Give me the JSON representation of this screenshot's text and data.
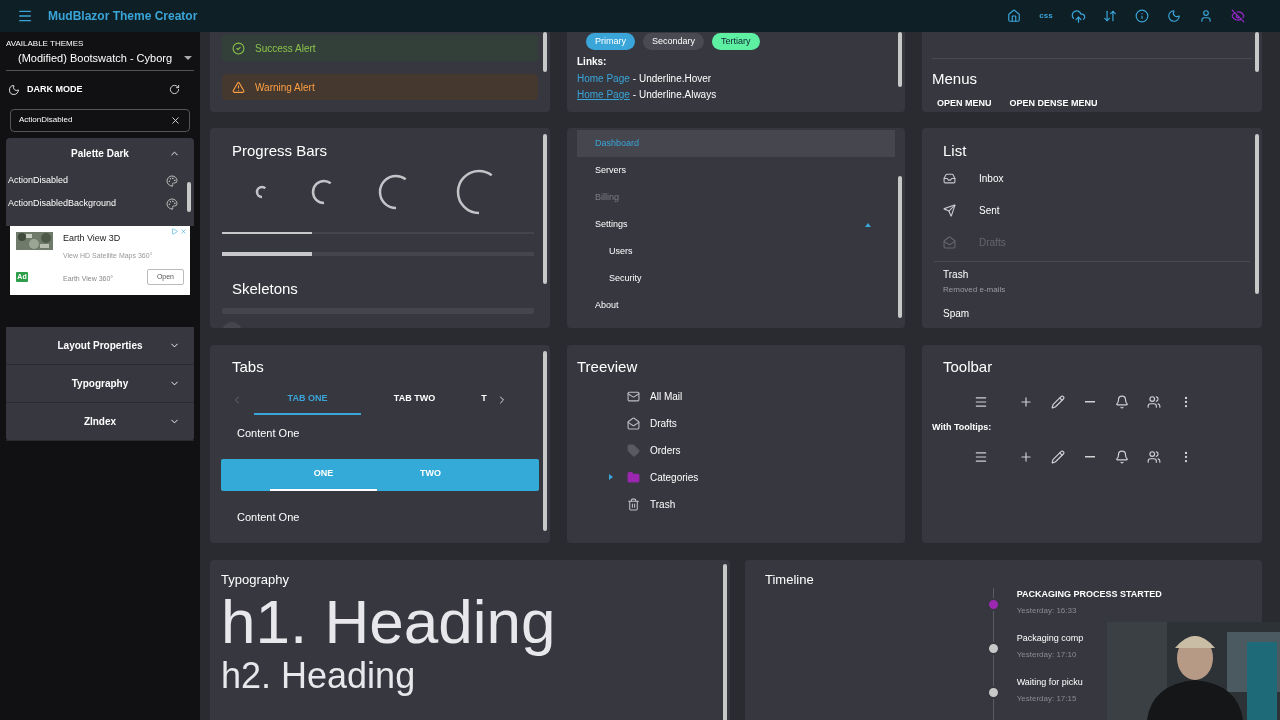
{
  "app_bar": {
    "title": "MudBlazor Theme Creator",
    "css_label": "css"
  },
  "sidebar": {
    "themes_label": "AVAILABLE THEMES",
    "theme": "(Modified) Bootswatch - Cyborg",
    "dark_mode_label": "DARK MODE",
    "search_value": "ActionDisabled",
    "palette_panel": {
      "title": "Palette Dark",
      "expanded": true,
      "items": [
        "ActionDisabled",
        "ActionDisabledBackground"
      ]
    },
    "ad": {
      "title": "Earth View 3D",
      "text": "View HD Satellite Maps 360°",
      "badge": "Ad",
      "source": "Earth View 360°",
      "button": "Open"
    },
    "panels": [
      {
        "title": "Layout Properties",
        "expanded": false
      },
      {
        "title": "Typography",
        "expanded": false
      },
      {
        "title": "ZIndex",
        "expanded": false
      }
    ]
  },
  "alerts": [
    {
      "kind": "success",
      "text": "Success Alert"
    },
    {
      "kind": "warning",
      "text": "Warning Alert"
    }
  ],
  "chips": [
    {
      "label": "Primary",
      "color": "#3aa5d8"
    },
    {
      "label": "Secondary",
      "color": "#4a4a52"
    },
    {
      "label": "Tertiary",
      "color": "#5ef0a2"
    }
  ],
  "links": {
    "label": "Links:",
    "items": [
      {
        "link": "Home Page",
        "text": "- Underline.Hover",
        "underline": false
      },
      {
        "link": "Home Page",
        "text": "- Underline.Always",
        "underline": true
      }
    ]
  },
  "menus": {
    "title": "Menus",
    "buttons": [
      "OPEN MENU",
      "OPEN DENSE MENU"
    ]
  },
  "progress": {
    "title": "Progress Bars",
    "bars": [
      {
        "level": 0.29
      },
      {
        "level": 0.29
      }
    ]
  },
  "skeletons": {
    "title": "Skeletons"
  },
  "nav_menu": [
    {
      "label": "Dashboard",
      "selected": true,
      "disabled": false
    },
    {
      "label": "Servers",
      "selected": false,
      "disabled": false
    },
    {
      "label": "Billing",
      "selected": false,
      "disabled": true
    },
    {
      "label": "Settings",
      "selected": false,
      "disabled": false,
      "expanded": true,
      "children": [
        {
          "label": "Users",
          "selected": false,
          "disabled": false
        },
        {
          "label": "Security",
          "selected": false,
          "disabled": false
        }
      ]
    },
    {
      "label": "About",
      "selected": false,
      "disabled": false
    }
  ],
  "list": {
    "title": "List",
    "items": [
      {
        "kind": "icon",
        "label": "Inbox",
        "disabled": false
      },
      {
        "kind": "icon",
        "label": "Sent",
        "disabled": false
      },
      {
        "kind": "icon",
        "label": "Drafts",
        "disabled": true
      },
      {
        "kind": "text",
        "label": "Trash",
        "secondary": "Removed e-mails",
        "disabled": false
      },
      {
        "kind": "text",
        "label": "Spam",
        "disabled": false
      }
    ]
  },
  "tabs": {
    "title": "Tabs",
    "items": [
      {
        "label": "TAB ONE",
        "selected": true
      },
      {
        "label": "TAB TWO",
        "selected": false
      },
      {
        "label": "T",
        "selected": false
      }
    ],
    "content": "Content One",
    "filled_tabs": [
      {
        "label": "ONE",
        "selected": true
      },
      {
        "label": "TWO",
        "selected": false
      }
    ],
    "filled_content": "Content One"
  },
  "treeview": {
    "title": "Treeview",
    "items": [
      {
        "label": "All Mail"
      },
      {
        "label": "Drafts"
      },
      {
        "label": "Orders"
      },
      {
        "label": "Categories",
        "expanded": false,
        "color": "#9c27b0"
      },
      {
        "label": "Trash"
      }
    ]
  },
  "toolbar": {
    "title": "Toolbar",
    "tooltips_label": "With Tooltips:"
  },
  "typography": {
    "title": "Typography",
    "h1": "h1. Heading",
    "h2": "h2. Heading"
  },
  "timeline": {
    "title": "Timeline",
    "items": [
      {
        "title": "PACKAGING PROCESS STARTED",
        "time": "Yesterday: 16:33",
        "color": "#9c27b0"
      },
      {
        "title": "Packaging comp",
        "time": "Yesterday: 17:10",
        "color": "#c8c8c8"
      },
      {
        "title": "Waiting for picku",
        "time": "Yesterday: 17:15",
        "color": "#c8c8c8"
      }
    ]
  }
}
